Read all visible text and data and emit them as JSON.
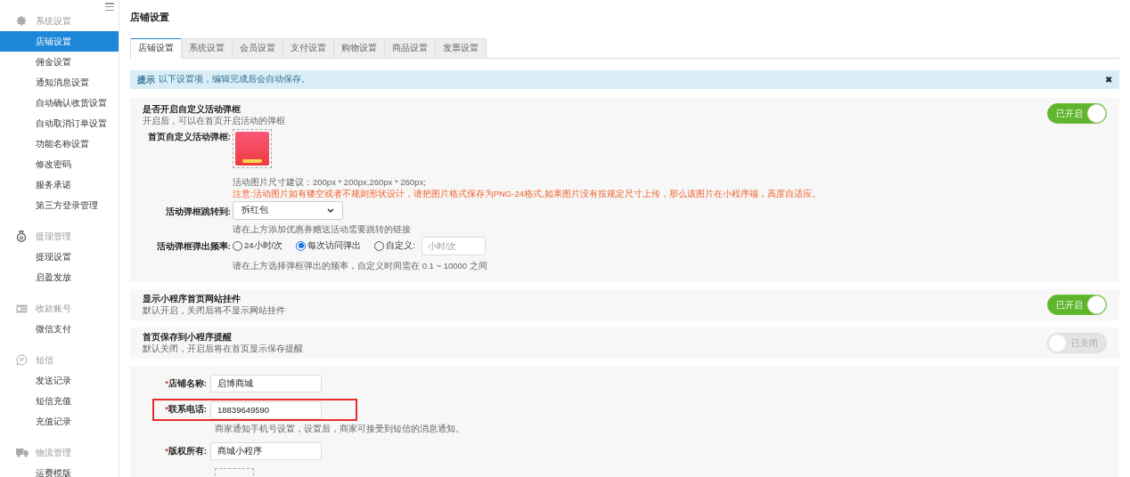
{
  "sidebar": {
    "groups": [
      {
        "title": "系统设置",
        "items": [
          {
            "label": "店铺设置",
            "selected": true
          },
          {
            "label": "佣金设置",
            "selected": false
          },
          {
            "label": "通知消息设置",
            "selected": false
          },
          {
            "label": "自动确认收货设置",
            "selected": false
          },
          {
            "label": "自动取消订单设置",
            "selected": false
          },
          {
            "label": "功能名称设置",
            "selected": false
          },
          {
            "label": "修改密码",
            "selected": false
          },
          {
            "label": "服务承诺",
            "selected": false
          },
          {
            "label": "第三方登录管理",
            "selected": false
          }
        ]
      },
      {
        "title": "提现管理",
        "items": [
          {
            "label": "提现设置",
            "selected": false
          },
          {
            "label": "启盈发放",
            "selected": false
          }
        ]
      },
      {
        "title": "收款账号",
        "items": [
          {
            "label": "微信支付",
            "selected": false
          }
        ]
      },
      {
        "title": "短信",
        "items": [
          {
            "label": "发送记录",
            "selected": false
          },
          {
            "label": "短信充值",
            "selected": false
          },
          {
            "label": "充值记录",
            "selected": false
          }
        ]
      },
      {
        "title": "物流管理",
        "items": [
          {
            "label": "运费模版",
            "selected": false
          }
        ]
      }
    ]
  },
  "page_title": "店铺设置",
  "tabs": [
    {
      "label": "店铺设置",
      "selected": true
    },
    {
      "label": "系统设置",
      "selected": false
    },
    {
      "label": "会员设置",
      "selected": false
    },
    {
      "label": "支付设置",
      "selected": false
    },
    {
      "label": "购物设置",
      "selected": false
    },
    {
      "label": "商品设置",
      "selected": false
    },
    {
      "label": "发票设置",
      "selected": false
    }
  ],
  "notice": {
    "label": "提示",
    "text": "以下设置项，编辑完成后会自动保存。",
    "close": "✖"
  },
  "popup_section": {
    "title": "是否开启自定义活动弹框",
    "description": "开启后，可以在首页开启活动的弹框",
    "switch": {
      "on": true,
      "label": "已开启"
    },
    "image_label": "首页自定义活动弹框:",
    "image_hint": "活动图片尺寸建议：200px * 200px,260px * 260px;",
    "warning": "注意:活动图片如有镂空或者不规则形状设计，请把图片格式保存为PNG-24格式,如果图片没有按规定尺寸上传，那么该图片在小程序端，高度自适应。",
    "jump_label": "活动弹框跳转到:",
    "jump_value": "拆红包",
    "jump_hint": "请在上方添加优惠券赠送活动需要跳转的链接",
    "frequency_label": "活动弹框弹出频率:",
    "frequency_options": [
      {
        "label": "24小时/次",
        "selected": false
      },
      {
        "label": "每次访问弹出",
        "selected": true
      },
      {
        "label": "自定义:",
        "selected": false
      }
    ],
    "custom_placeholder": "小时/次",
    "frequency_hint": "请在上方选择弹框弹出的频率，自定义时间需在 0.1 ~ 10000 之间"
  },
  "toggle_sections": [
    {
      "title": "显示小程序首页网站挂件",
      "description": "默认开启，关闭后将不显示网站挂件",
      "switch": {
        "on": true,
        "label": "已开启"
      }
    },
    {
      "title": "首页保存到小程序提醒",
      "description": "默认关闭，开启后将在首页显示保存提醒",
      "switch": {
        "on": false,
        "label": "已关闭"
      }
    }
  ],
  "form": {
    "fields": [
      {
        "required_mark": "*",
        "label": "店铺名称:",
        "value": "启博商城",
        "highlighted": false
      },
      {
        "required_mark": "*",
        "label": "联系电话:",
        "value": "18839649590",
        "highlighted": true,
        "hint": "商家通知手机号设置，设置后，商家可接受到短信的消息通知。"
      },
      {
        "required_mark": "*",
        "label": "版权所有:",
        "value": "商城小程序",
        "highlighted": false
      }
    ]
  }
}
